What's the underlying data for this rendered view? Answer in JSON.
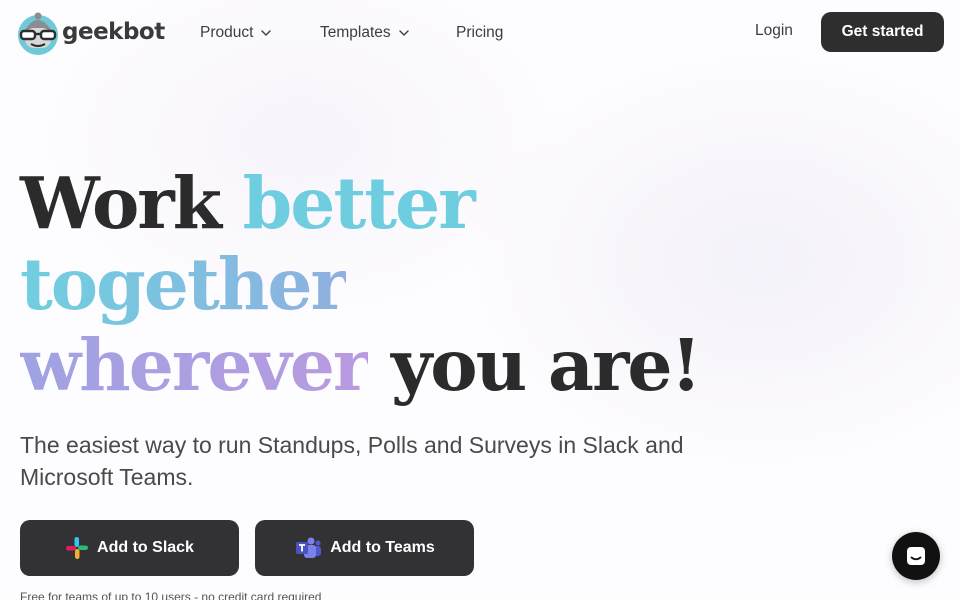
{
  "nav": {
    "brand": "geekbot",
    "items": [
      {
        "label": "Product",
        "has_dropdown": true
      },
      {
        "label": "Templates",
        "has_dropdown": true
      },
      {
        "label": "Pricing",
        "has_dropdown": false
      }
    ],
    "login": "Login",
    "cta": "Get started"
  },
  "hero": {
    "headline": {
      "l1a": "Work",
      "l1b": "better",
      "l2": "together",
      "l3a": "wherever",
      "l3b": "you are!"
    },
    "subtitle": "The easiest way to run Standups, Polls and Surveys in Slack and Microsoft Teams.",
    "buttons": {
      "slack": "Add to Slack",
      "teams": "Add to Teams"
    },
    "footnote": "Free for teams of up to 10 users - no credit card required"
  },
  "icons": {
    "logo": "geekbot-robot-logo-icon",
    "chevron": "chevron-down-icon",
    "slack": "slack-logo-icon",
    "teams": "teams-logo-icon",
    "chat": "chat-bubble-icon"
  },
  "colors": {
    "button_dark": "#2e2e2f",
    "accent_teal": "#6fcde0",
    "accent_purple": "#b99ae0"
  }
}
